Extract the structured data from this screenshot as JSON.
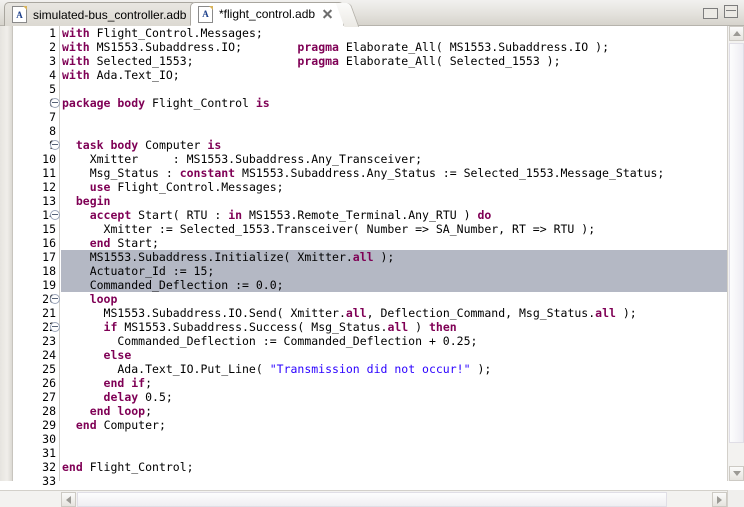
{
  "window": {
    "minimize_label": "Minimize",
    "maximize_label": "Maximize"
  },
  "tabs": [
    {
      "label": "simulated-bus_controller.adb",
      "icon": "ada-file-icon",
      "icon_letter": "A",
      "active": false,
      "modified": false
    },
    {
      "label": "*flight_control.adb",
      "icon": "ada-file-icon",
      "icon_letter": "A",
      "active": true,
      "modified": true
    }
  ],
  "editor": {
    "language": "ada",
    "selected_lines": [
      17,
      18,
      19
    ],
    "fold_lines": [
      6,
      9,
      14,
      20,
      22
    ],
    "first_visible_line": 1,
    "last_visible_line": 33,
    "colors": {
      "keyword": "#7f0055",
      "string": "#2a00ff",
      "text": "#000000",
      "selection": "#b4b8c4",
      "background": "#ffffff",
      "line_number": "#7a7a7a"
    },
    "lines": [
      {
        "n": 1,
        "fold": false,
        "sel": false,
        "tokens": [
          {
            "t": "kw",
            "s": "with"
          },
          {
            "t": "p",
            "s": " Flight_Control.Messages;"
          }
        ]
      },
      {
        "n": 2,
        "fold": false,
        "sel": false,
        "tokens": [
          {
            "t": "kw",
            "s": "with"
          },
          {
            "t": "p",
            "s": " MS1553.Subaddress.IO;        "
          },
          {
            "t": "kw",
            "s": "pragma"
          },
          {
            "t": "p",
            "s": " Elaborate_All( MS1553.Subaddress.IO );"
          }
        ]
      },
      {
        "n": 3,
        "fold": false,
        "sel": false,
        "tokens": [
          {
            "t": "kw",
            "s": "with"
          },
          {
            "t": "p",
            "s": " Selected_1553;               "
          },
          {
            "t": "kw",
            "s": "pragma"
          },
          {
            "t": "p",
            "s": " Elaborate_All( Selected_1553 );"
          }
        ]
      },
      {
        "n": 4,
        "fold": false,
        "sel": false,
        "tokens": [
          {
            "t": "kw",
            "s": "with"
          },
          {
            "t": "p",
            "s": " Ada.Text_IO;"
          }
        ]
      },
      {
        "n": 5,
        "fold": false,
        "sel": false,
        "tokens": []
      },
      {
        "n": 6,
        "fold": true,
        "sel": false,
        "tokens": [
          {
            "t": "kw",
            "s": "package body"
          },
          {
            "t": "p",
            "s": " Flight_Control "
          },
          {
            "t": "kw",
            "s": "is"
          }
        ]
      },
      {
        "n": 7,
        "fold": false,
        "sel": false,
        "tokens": []
      },
      {
        "n": 8,
        "fold": false,
        "sel": false,
        "tokens": []
      },
      {
        "n": 9,
        "fold": true,
        "sel": false,
        "tokens": [
          {
            "t": "p",
            "s": "  "
          },
          {
            "t": "kw",
            "s": "task body"
          },
          {
            "t": "p",
            "s": " Computer "
          },
          {
            "t": "kw",
            "s": "is"
          }
        ]
      },
      {
        "n": 10,
        "fold": false,
        "sel": false,
        "tokens": [
          {
            "t": "p",
            "s": "    Xmitter     : MS1553.Subaddress.Any_Transceiver;"
          }
        ]
      },
      {
        "n": 11,
        "fold": false,
        "sel": false,
        "tokens": [
          {
            "t": "p",
            "s": "    Msg_Status : "
          },
          {
            "t": "kw",
            "s": "constant"
          },
          {
            "t": "p",
            "s": " MS1553.Subaddress.Any_Status := Selected_1553.Message_Status;"
          }
        ]
      },
      {
        "n": 12,
        "fold": false,
        "sel": false,
        "tokens": [
          {
            "t": "p",
            "s": "    "
          },
          {
            "t": "kw",
            "s": "use"
          },
          {
            "t": "p",
            "s": " Flight_Control.Messages;"
          }
        ]
      },
      {
        "n": 13,
        "fold": false,
        "sel": false,
        "tokens": [
          {
            "t": "p",
            "s": "  "
          },
          {
            "t": "kw",
            "s": "begin"
          }
        ]
      },
      {
        "n": 14,
        "fold": true,
        "sel": false,
        "tokens": [
          {
            "t": "p",
            "s": "    "
          },
          {
            "t": "kw",
            "s": "accept"
          },
          {
            "t": "p",
            "s": " Start( RTU : "
          },
          {
            "t": "kw",
            "s": "in"
          },
          {
            "t": "p",
            "s": " MS1553.Remote_Terminal.Any_RTU ) "
          },
          {
            "t": "kw",
            "s": "do"
          }
        ]
      },
      {
        "n": 15,
        "fold": false,
        "sel": false,
        "tokens": [
          {
            "t": "p",
            "s": "      Xmitter := Selected_1553.Transceiver( Number => SA_Number, RT => RTU );"
          }
        ]
      },
      {
        "n": 16,
        "fold": false,
        "sel": false,
        "tokens": [
          {
            "t": "p",
            "s": "    "
          },
          {
            "t": "kw",
            "s": "end"
          },
          {
            "t": "p",
            "s": " Start;"
          }
        ]
      },
      {
        "n": 17,
        "fold": false,
        "sel": true,
        "tokens": [
          {
            "t": "p",
            "s": "    MS1553.Subaddress.Initialize( Xmitter."
          },
          {
            "t": "kw",
            "s": "all"
          },
          {
            "t": "p",
            "s": " );"
          }
        ]
      },
      {
        "n": 18,
        "fold": false,
        "sel": true,
        "tokens": [
          {
            "t": "p",
            "s": "    Actuator_Id := 15;"
          }
        ]
      },
      {
        "n": 19,
        "fold": false,
        "sel": true,
        "tokens": [
          {
            "t": "p",
            "s": "    Commanded_Deflection := 0.0;"
          }
        ]
      },
      {
        "n": 20,
        "fold": true,
        "sel": false,
        "tokens": [
          {
            "t": "p",
            "s": "    "
          },
          {
            "t": "kw",
            "s": "loop"
          }
        ]
      },
      {
        "n": 21,
        "fold": false,
        "sel": false,
        "tokens": [
          {
            "t": "p",
            "s": "      MS1553.Subaddress.IO.Send( Xmitter."
          },
          {
            "t": "kw",
            "s": "all"
          },
          {
            "t": "p",
            "s": ", Deflection_Command, Msg_Status."
          },
          {
            "t": "kw",
            "s": "all"
          },
          {
            "t": "p",
            "s": " );"
          }
        ]
      },
      {
        "n": 22,
        "fold": true,
        "sel": false,
        "tokens": [
          {
            "t": "p",
            "s": "      "
          },
          {
            "t": "kw",
            "s": "if"
          },
          {
            "t": "p",
            "s": " MS1553.Subaddress.Success( Msg_Status."
          },
          {
            "t": "kw",
            "s": "all"
          },
          {
            "t": "p",
            "s": " ) "
          },
          {
            "t": "kw",
            "s": "then"
          }
        ]
      },
      {
        "n": 23,
        "fold": false,
        "sel": false,
        "tokens": [
          {
            "t": "p",
            "s": "        Commanded_Deflection := Commanded_Deflection + 0.25;"
          }
        ]
      },
      {
        "n": 24,
        "fold": false,
        "sel": false,
        "tokens": [
          {
            "t": "p",
            "s": "      "
          },
          {
            "t": "kw",
            "s": "else"
          }
        ]
      },
      {
        "n": 25,
        "fold": false,
        "sel": false,
        "tokens": [
          {
            "t": "p",
            "s": "        Ada.Text_IO.Put_Line( "
          },
          {
            "t": "str",
            "s": "\"Transmission did not occur!\""
          },
          {
            "t": "p",
            "s": " );"
          }
        ]
      },
      {
        "n": 26,
        "fold": false,
        "sel": false,
        "tokens": [
          {
            "t": "p",
            "s": "      "
          },
          {
            "t": "kw",
            "s": "end if"
          },
          {
            "t": "p",
            "s": ";"
          }
        ]
      },
      {
        "n": 27,
        "fold": false,
        "sel": false,
        "tokens": [
          {
            "t": "p",
            "s": "      "
          },
          {
            "t": "kw",
            "s": "delay"
          },
          {
            "t": "p",
            "s": " 0.5;"
          }
        ]
      },
      {
        "n": 28,
        "fold": false,
        "sel": false,
        "tokens": [
          {
            "t": "p",
            "s": "    "
          },
          {
            "t": "kw",
            "s": "end loop"
          },
          {
            "t": "p",
            "s": ";"
          }
        ]
      },
      {
        "n": 29,
        "fold": false,
        "sel": false,
        "tokens": [
          {
            "t": "p",
            "s": "  "
          },
          {
            "t": "kw",
            "s": "end"
          },
          {
            "t": "p",
            "s": " Computer;"
          }
        ]
      },
      {
        "n": 30,
        "fold": false,
        "sel": false,
        "tokens": []
      },
      {
        "n": 31,
        "fold": false,
        "sel": false,
        "tokens": []
      },
      {
        "n": 32,
        "fold": false,
        "sel": false,
        "tokens": [
          {
            "t": "kw",
            "s": "end"
          },
          {
            "t": "p",
            "s": " Flight_Control;"
          }
        ]
      },
      {
        "n": 33,
        "fold": false,
        "sel": false,
        "tokens": []
      }
    ]
  },
  "scrollbars": {
    "vertical": {
      "up_icon": "chevron-up-icon",
      "down_icon": "chevron-down-icon"
    },
    "horizontal": {
      "left_icon": "chevron-left-icon",
      "right_icon": "chevron-right-icon"
    }
  }
}
